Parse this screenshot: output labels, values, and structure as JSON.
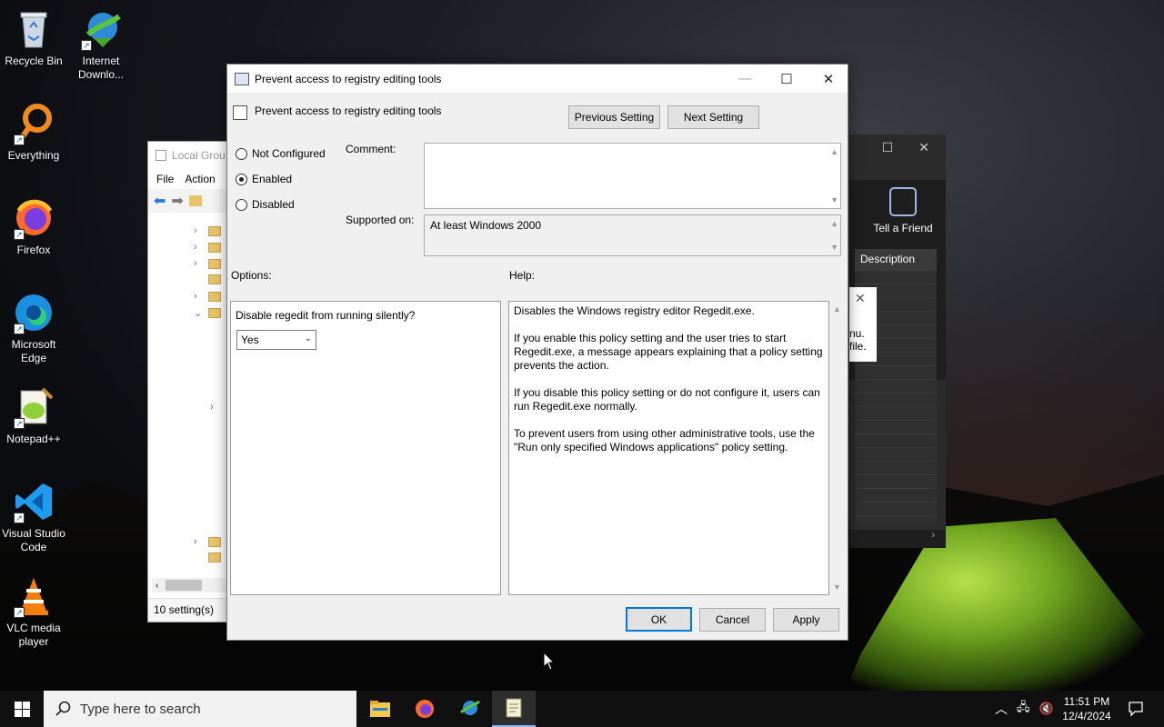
{
  "desktop": {
    "icons": [
      {
        "label": "Recycle Bin",
        "icon": "recycle-bin-icon"
      },
      {
        "label": "Internet Downlo...",
        "icon": "internet-download-manager-icon"
      },
      {
        "label": "Everything",
        "icon": "everything-search-icon"
      },
      {
        "label": "Firefox",
        "icon": "firefox-icon"
      },
      {
        "label": "Microsoft Edge",
        "icon": "edge-icon"
      },
      {
        "label": "Notepad++",
        "icon": "notepadpp-icon"
      },
      {
        "label": "Visual Studio Code",
        "icon": "vscode-icon"
      },
      {
        "label": "VLC media player",
        "icon": "vlc-icon"
      }
    ]
  },
  "bg_window": {
    "title": "Local Grou",
    "menu": [
      "File",
      "Action"
    ],
    "status": "10 setting(s)"
  },
  "right_window": {
    "tell_friend": "Tell a Friend",
    "column": "Description",
    "popup_line1": "nu.",
    "popup_line2": "file."
  },
  "dialog": {
    "title": "Prevent access to registry editing tools",
    "header": "Prevent access to registry editing tools",
    "prev_button": "Previous Setting",
    "next_button": "Next Setting",
    "radios": [
      {
        "label": "Not Configured",
        "selected": false
      },
      {
        "label": "Enabled",
        "selected": true
      },
      {
        "label": "Disabled",
        "selected": false
      }
    ],
    "comment_label": "Comment:",
    "comment_value": "",
    "supported_label": "Supported on:",
    "supported_value": "At least Windows 2000",
    "options_label": "Options:",
    "help_label": "Help:",
    "option_question": "Disable regedit from running silently?",
    "option_value": "Yes",
    "help_paragraphs": [
      "Disables the Windows registry editor Regedit.exe.",
      "If you enable this policy setting and the user tries to start Regedit.exe, a message appears explaining that a policy setting prevents the action.",
      "If you disable this policy setting or do not configure it, users can run Regedit.exe normally.",
      "To prevent users from using other administrative tools, use the \"Run only specified Windows applications\" policy setting."
    ],
    "ok": "OK",
    "cancel": "Cancel",
    "apply": "Apply"
  },
  "taskbar": {
    "search_placeholder": "Type here to search",
    "time": "11:51 PM",
    "date": "12/4/2024",
    "apps": [
      "file-explorer-icon",
      "firefox-icon",
      "internet-download-manager-icon",
      "notepad-icon"
    ]
  },
  "colors": {
    "accent": "#0078d7",
    "taskbar": "#101010"
  }
}
